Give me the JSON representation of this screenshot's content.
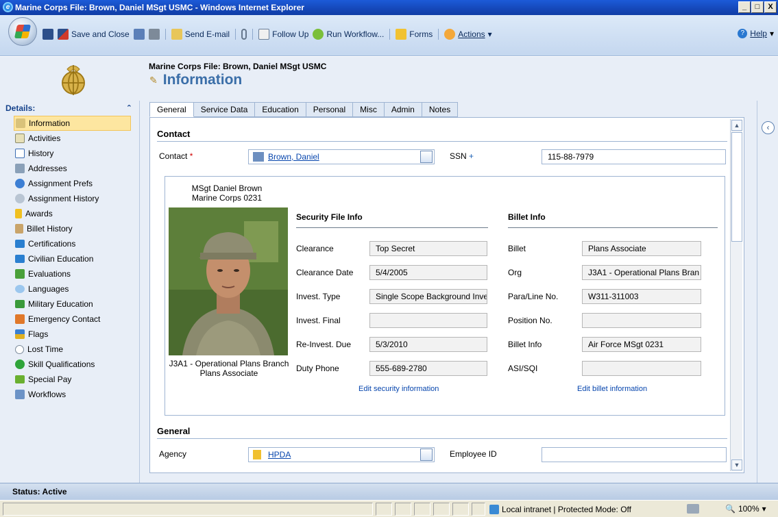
{
  "window": {
    "title": "Marine Corps File: Brown, Daniel MSgt USMC - Windows Internet Explorer",
    "min_label": "_",
    "max_label": "□",
    "close_label": "X"
  },
  "toolbar": {
    "save_close": "Save and Close",
    "send_email": "Send E-mail",
    "follow_up": "Follow Up",
    "run_workflow": "Run Workflow...",
    "forms": "Forms",
    "actions": "Actions",
    "help": "Help"
  },
  "header": {
    "record_title": "Marine Corps File: Brown, Daniel MSgt USMC",
    "section_title": "Information"
  },
  "nav": {
    "heading": "Details:",
    "items": [
      {
        "label": "Information"
      },
      {
        "label": "Activities"
      },
      {
        "label": "History"
      },
      {
        "label": "Addresses"
      },
      {
        "label": "Assignment Prefs"
      },
      {
        "label": "Assignment History"
      },
      {
        "label": "Awards"
      },
      {
        "label": "Billet History"
      },
      {
        "label": "Certifications"
      },
      {
        "label": "Civilian Education"
      },
      {
        "label": "Evaluations"
      },
      {
        "label": "Languages"
      },
      {
        "label": "Military Education"
      },
      {
        "label": "Emergency Contact"
      },
      {
        "label": "Flags"
      },
      {
        "label": "Lost Time"
      },
      {
        "label": "Skill Qualifications"
      },
      {
        "label": "Special Pay"
      },
      {
        "label": "Workflows"
      }
    ]
  },
  "tabs": [
    "General",
    "Service Data",
    "Education",
    "Personal",
    "Misc",
    "Admin",
    "Notes"
  ],
  "contact": {
    "section": "Contact",
    "contact_label": "Contact",
    "required_mark": "*",
    "contact_value": "Brown, Daniel",
    "ssn_label": "SSN",
    "recommended_mark": "+",
    "ssn_value": "115-88-7979"
  },
  "card": {
    "name_line1": "MSgt Daniel Brown",
    "name_line2": "Marine Corps  0231",
    "photo_caption1": "J3A1 - Operational Plans Branch",
    "photo_caption2": "Plans Associate",
    "security": {
      "heading": "Security File Info",
      "clearance_label": "Clearance",
      "clearance": "Top Secret",
      "clearance_date_label": "Clearance Date",
      "clearance_date": "5/4/2005",
      "invest_type_label": "Invest. Type",
      "invest_type": "Single Scope Background Inve",
      "invest_final_label": "Invest. Final",
      "invest_final": "",
      "reinvest_label": "Re-Invest. Due",
      "reinvest": "5/3/2010",
      "duty_phone_label": "Duty Phone",
      "duty_phone": "555-689-2780",
      "edit_link": "Edit security information"
    },
    "billet": {
      "heading": "Billet Info",
      "billet_label": "Billet",
      "billet": "Plans Associate",
      "org_label": "Org",
      "org": "J3A1 - Operational Plans Bran",
      "para_label": "Para/Line No.",
      "para": "W311-311003",
      "position_label": "Position No.",
      "position": "",
      "billet_info_label": "Billet Info",
      "billet_info": "Air Force MSgt 0231",
      "asi_label": "ASI/SQI",
      "asi": "",
      "edit_link": "Edit billet information"
    }
  },
  "general": {
    "section": "General",
    "agency_label": "Agency",
    "agency_value": "HPDA",
    "employee_id_label": "Employee ID",
    "employee_id_value": ""
  },
  "status": {
    "text": "Status: Active"
  },
  "ie": {
    "zone": "Local intranet | Protected Mode: Off",
    "zoom": "100%"
  },
  "colors": {
    "accent": "#3a6ea8",
    "nav_bg": "#e8eef7",
    "active_nav": "#fde6a0",
    "required": "#d00000",
    "link": "#0645ad"
  }
}
